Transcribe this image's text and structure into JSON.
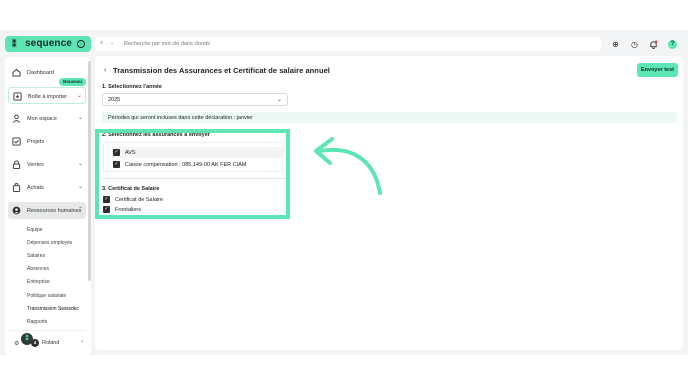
{
  "brand": {
    "name": "sequence",
    "mark": "⁑"
  },
  "topbar": {
    "search_placeholder": "Recherche par mot clé dans clients"
  },
  "sidebar": {
    "items": [
      {
        "label": "Dashboard"
      },
      {
        "label": "Boîte à importer",
        "badge": "Nouveau"
      },
      {
        "label": "Mon espace"
      },
      {
        "label": "Projets"
      },
      {
        "label": "Ventes"
      },
      {
        "label": "Achats"
      },
      {
        "label": "Ressources humaines"
      }
    ],
    "sub_items": [
      {
        "label": "Equipe"
      },
      {
        "label": "Dépenses employés"
      },
      {
        "label": "Salaires"
      },
      {
        "label": "Absences"
      },
      {
        "label": "Entreprise"
      },
      {
        "label": "Politique salariale"
      },
      {
        "label": "Transmission Swissdec"
      },
      {
        "label": "Rapports"
      }
    ],
    "user": {
      "name": "Roland",
      "notification_count": "4"
    }
  },
  "main": {
    "title": "Transmission des Assurances et Certificat de salaire annuel",
    "test_button": "Envoyer test",
    "section1": {
      "title": "1. Sélectionnez l'année",
      "selected_year": "2025"
    },
    "info": "Périodes qui seront incluses dans cette déclaration : janvier",
    "section2": {
      "title": "2. Sélectionnez les assurances à envoyer",
      "items": [
        {
          "label": "AVS",
          "checked": true
        },
        {
          "label": "Caisse compensation : 085.149-00  AK FER CIAM",
          "checked": true
        }
      ]
    },
    "section3": {
      "title": "3. Certificat de Salaire",
      "items": [
        {
          "label": "Certificat de Salaire",
          "checked": true
        },
        {
          "label": "Frontaliers",
          "checked": true
        }
      ]
    }
  },
  "colors": {
    "accent": "#5ee5b4",
    "dark": "#2e2e2e",
    "info_bg": "#ecf9f4"
  }
}
